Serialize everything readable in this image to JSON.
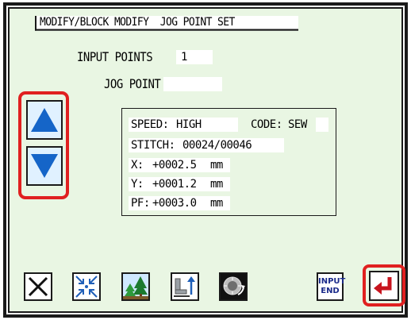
{
  "header": {
    "title": "MODIFY/BLOCK MODIFY  JOG POINT SET"
  },
  "form": {
    "input_points_label": "INPUT POINTS",
    "input_points_value": "1",
    "jog_point_label": "JOG POINT",
    "jog_point_value": ""
  },
  "info": {
    "speed_label": "SPEED:",
    "speed_value": "HIGH",
    "code_label": "CODE:",
    "code_value": "SEW",
    "stitch_label": "STITCH:",
    "stitch_value": "00024/00046",
    "x_label": "X:",
    "x_value": "+0002.5",
    "y_label": "Y:",
    "y_value": "+0001.2",
    "pf_label": "PF:",
    "pf_value": "+0003.0",
    "unit": "mm"
  },
  "toolbar": {
    "input_end_line1": "INPUT",
    "input_end_line2": "END"
  },
  "colors": {
    "screen_bg": "#e9f6e3",
    "highlight": "#e02020",
    "arrow_blue": "#1565c8",
    "enter_red": "#c8141e"
  },
  "icons": {
    "up": "arrow-up-icon",
    "down": "arrow-down-icon",
    "cancel": "cancel-x-icon",
    "collapse": "collapse-arrows-icon",
    "scenery": "trees-scenery-icon",
    "presser": "presser-foot-up-icon",
    "knob": "pulley-knob-icon",
    "enter": "enter-return-icon"
  }
}
